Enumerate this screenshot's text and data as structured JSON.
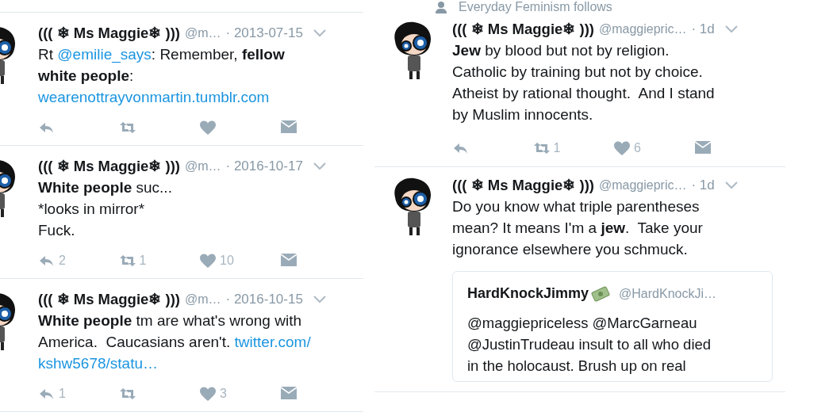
{
  "left_column": {
    "tweets": [
      {
        "name": "((( ❄ Ms Maggie❄ )))",
        "handle": "@m…",
        "time": "· 2013-07-15",
        "lines": [
          [
            {
              "kind": "text",
              "text": "Rt "
            },
            {
              "kind": "mention",
              "text": "@emilie_says"
            },
            {
              "kind": "text",
              "text": ": Remember, "
            },
            {
              "kind": "bold",
              "text": "fellow"
            }
          ],
          [
            {
              "kind": "bold",
              "text": "white people"
            },
            {
              "kind": "text",
              "text": ":"
            }
          ],
          [
            {
              "kind": "link",
              "text": "wearenottrayvonmartin.tumblr.com"
            }
          ]
        ],
        "actions": [
          {
            "kind": "reply"
          },
          {
            "kind": "retweet"
          },
          {
            "kind": "like"
          },
          {
            "kind": "message"
          }
        ]
      },
      {
        "name": "((( ❄ Ms Maggie❄ )))",
        "handle": "@m…",
        "time": "· 2016-10-17",
        "lines": [
          [
            {
              "kind": "bold",
              "text": "White people"
            },
            {
              "kind": "text",
              "text": " suc..."
            }
          ],
          [
            {
              "kind": "text",
              "text": "*looks in mirror*"
            }
          ],
          [
            {
              "kind": "text",
              "text": "Fuck."
            }
          ]
        ],
        "actions": [
          {
            "kind": "reply",
            "count": "2"
          },
          {
            "kind": "retweet",
            "count": "1"
          },
          {
            "kind": "like",
            "count": "10"
          },
          {
            "kind": "message"
          }
        ]
      },
      {
        "name": "((( ❄ Ms Maggie❄ )))",
        "handle": "@m…",
        "time": "· 2016-10-15",
        "lines": [
          [
            {
              "kind": "bold",
              "text": "White people"
            },
            {
              "kind": "text",
              "text": " tm are what's wrong with"
            }
          ],
          [
            {
              "kind": "text",
              "text": "America.  Caucasians aren't. "
            },
            {
              "kind": "link",
              "text": "twitter.com/"
            }
          ],
          [
            {
              "kind": "link",
              "text": "kshw5678/statu…"
            }
          ]
        ],
        "actions": [
          {
            "kind": "reply",
            "count": "1"
          },
          {
            "kind": "retweet"
          },
          {
            "kind": "like",
            "count": "3"
          },
          {
            "kind": "message"
          }
        ]
      }
    ]
  },
  "right_column": {
    "social_context": "Everyday Feminism follows",
    "tweets": [
      {
        "name": "((( ❄ Ms Maggie❄ )))",
        "handle": "@maggiepric…",
        "time": "· 1d",
        "lines": [
          [
            {
              "kind": "bold",
              "text": "Jew"
            },
            {
              "kind": "text",
              "text": " by blood but not by religion."
            }
          ],
          [
            {
              "kind": "text",
              "text": "Catholic by training but not by choice."
            }
          ],
          [
            {
              "kind": "text",
              "text": "Atheist by rational thought.  And I stand"
            }
          ],
          [
            {
              "kind": "text",
              "text": "by Muslim innocents."
            }
          ]
        ],
        "actions": [
          {
            "kind": "reply"
          },
          {
            "kind": "retweet",
            "count": "1"
          },
          {
            "kind": "like",
            "count": "6"
          },
          {
            "kind": "message"
          }
        ]
      },
      {
        "name": "((( ❄ Ms Maggie❄ )))",
        "handle": "@maggiepric…",
        "time": "· 1d",
        "lines": [
          [
            {
              "kind": "text",
              "text": "Do you know what triple parentheses"
            }
          ],
          [
            {
              "kind": "text",
              "text": "mean? It means I'm a "
            },
            {
              "kind": "bold",
              "text": "jew"
            },
            {
              "kind": "text",
              "text": ".  Take your"
            }
          ],
          [
            {
              "kind": "text",
              "text": "ignorance elsewhere you schmuck."
            }
          ]
        ],
        "quoted": {
          "name": "HardKnockJimmy",
          "handle": "@HardKnockJi…",
          "lines": [
            "@maggiepriceless @MarcGarneau",
            "@JustinTrudeau insult to all who died",
            "in the holocaust. Brush up on real"
          ]
        }
      }
    ]
  }
}
